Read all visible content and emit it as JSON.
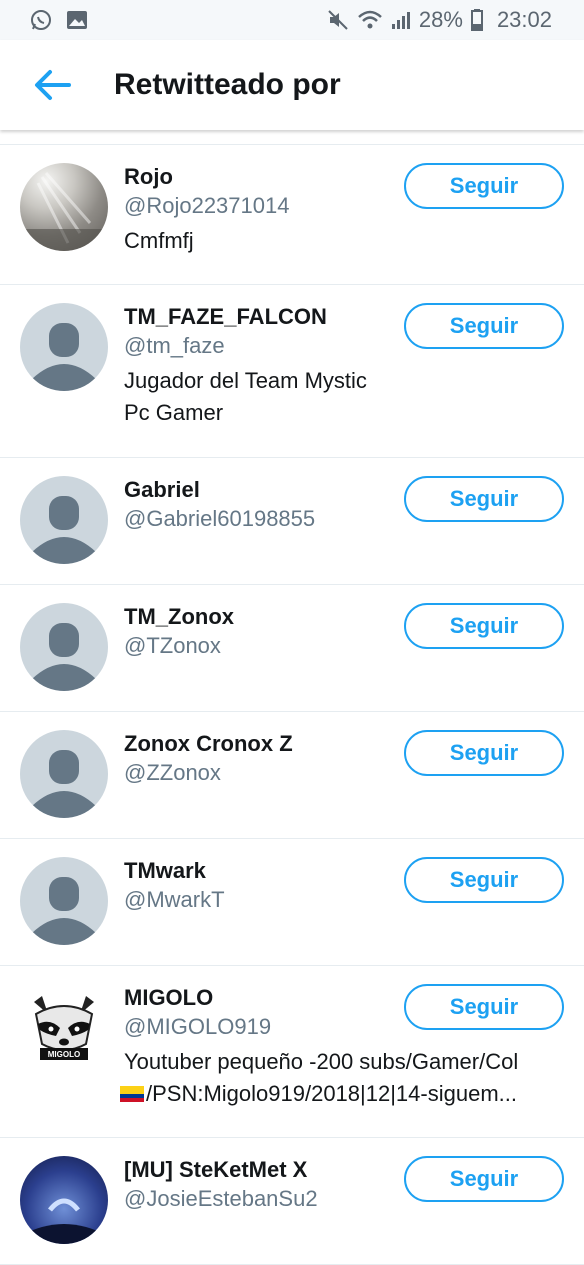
{
  "status_bar": {
    "battery_percent": "28%",
    "time": "23:02",
    "icons": [
      "whatsapp-icon",
      "gallery-icon",
      "mute-icon",
      "wifi-icon",
      "signal-icon",
      "battery-icon"
    ]
  },
  "header": {
    "title": "Retwitteado por"
  },
  "colors": {
    "accent": "#1da1f2",
    "handle": "#657786",
    "divider": "#e6ecf0",
    "default_avatar": "#ccd6dd"
  },
  "users": [
    {
      "name": "Rojo",
      "handle": "@Rojo22371014",
      "bio": "Cmfmfj",
      "bio2": "",
      "follow_label": "Seguir",
      "avatar": "photo"
    },
    {
      "name": "TM_FAZE_FALCON",
      "handle": "@tm_faze",
      "bio": "Jugador del Team Mystic",
      "bio2": "Pc Gamer",
      "follow_label": "Seguir",
      "avatar": "default"
    },
    {
      "name": "Gabriel",
      "handle": "@Gabriel60198855",
      "bio": "",
      "bio2": "",
      "follow_label": "Seguir",
      "avatar": "default"
    },
    {
      "name": "TM_Zonox",
      "handle": "@TZonox",
      "bio": "",
      "bio2": "",
      "follow_label": "Seguir",
      "avatar": "default"
    },
    {
      "name": "Zonox Cronox Z",
      "handle": "@ZZonox",
      "bio": "",
      "bio2": "",
      "follow_label": "Seguir",
      "avatar": "default"
    },
    {
      "name": "TMwark",
      "handle": "@MwarkT",
      "bio": "",
      "bio2": "",
      "follow_label": "Seguir",
      "avatar": "default"
    },
    {
      "name": "MIGOLO",
      "handle": "@MIGOLO919",
      "bio": "Youtuber pequeño -200 subs/Gamer/Col",
      "bio2": "/PSN:Migolo919/2018|12|14-siguem...",
      "follow_label": "Seguir",
      "avatar": "raccoon",
      "avatar_text": "MIGOLO"
    },
    {
      "name": "[MU] SteKetMet X",
      "handle": "@JosieEstebanSu2",
      "bio": "",
      "bio2": "",
      "follow_label": "Seguir",
      "avatar": "photo-blue"
    }
  ]
}
